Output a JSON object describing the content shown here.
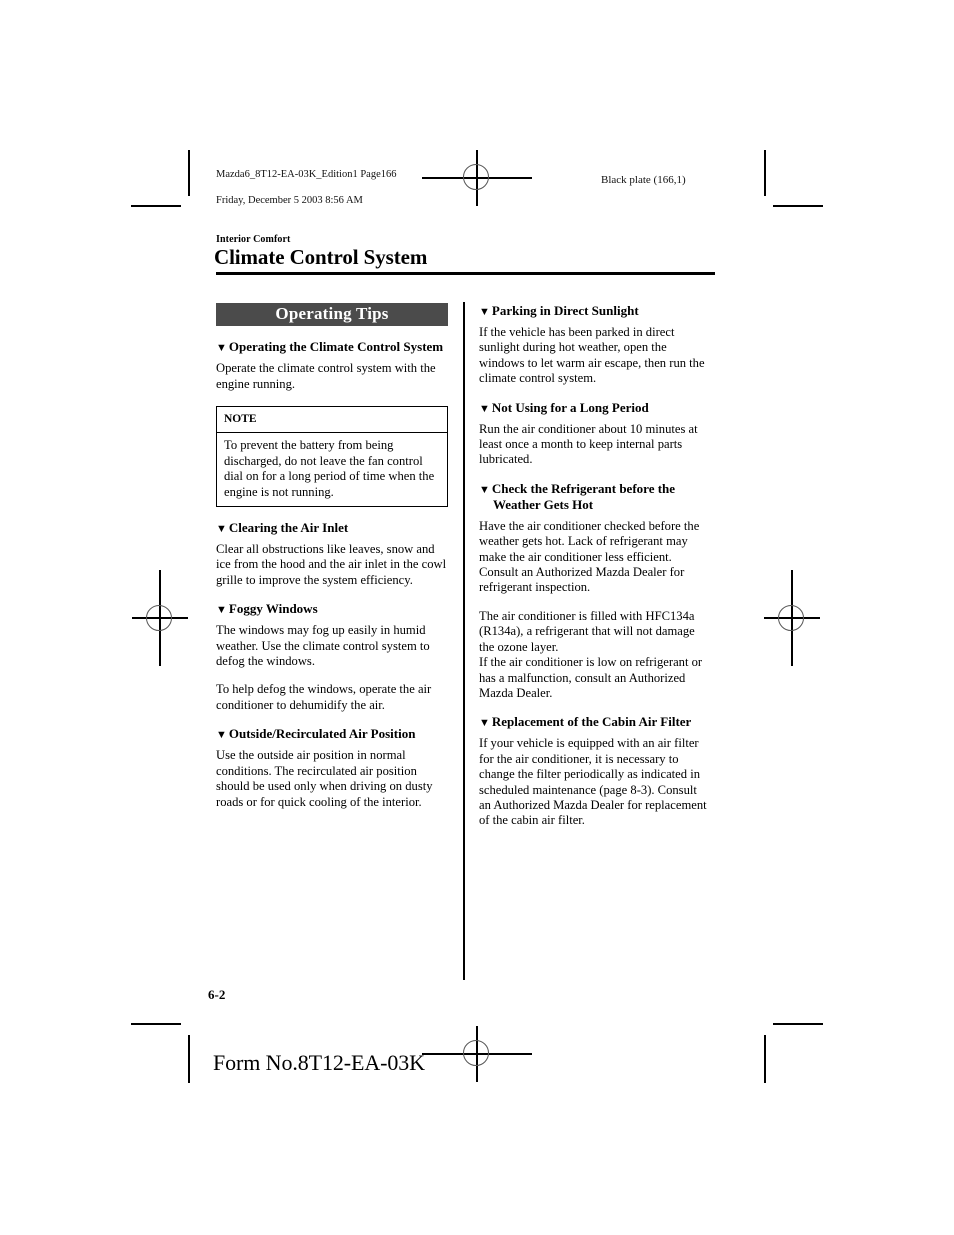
{
  "imprint": {
    "left_line1": "Mazda6_8T12-EA-03K_Edition1 Page166",
    "left_line2": "Friday, December 5 2003 8:56 AM",
    "right": "Black plate (166,1)"
  },
  "header": {
    "eyebrow": "Interior Comfort",
    "title": "Climate Control System"
  },
  "left_column": {
    "band_label": "Operating Tips",
    "sections": [
      {
        "marker": "▼",
        "heading": "Operating the Climate Control System",
        "paragraphs": [
          "Operate the climate control system with the engine running."
        ]
      },
      {
        "marker": "▼",
        "heading": "Clearing the Air Inlet",
        "paragraphs": [
          "Clear all obstructions like leaves, snow and ice from the hood and the air inlet in the cowl grille to improve the system efficiency."
        ]
      },
      {
        "marker": "▼",
        "heading": "Foggy Windows",
        "paragraphs": [
          "The windows may fog up easily in humid weather. Use the climate control system to defog the windows.",
          "To help defog the windows, operate the air conditioner to dehumidify the air."
        ]
      },
      {
        "marker": "▼",
        "heading": "Outside/Recirculated Air Position",
        "paragraphs": [
          "Use the outside air position in normal conditions. The recirculated air position should be used only when driving on dusty roads or for quick cooling of the interior."
        ]
      }
    ],
    "note": {
      "title": "NOTE",
      "text": "To prevent the battery from being discharged, do not leave the fan control dial on for a long period of time when the engine is not running."
    }
  },
  "right_column": {
    "sections": [
      {
        "marker": "▼",
        "heading": "Parking in Direct Sunlight",
        "paragraphs": [
          "If the vehicle has been parked in direct sunlight during hot weather, open the windows to let warm air escape, then run the climate control system."
        ]
      },
      {
        "marker": "▼",
        "heading": "Not Using for a Long Period",
        "paragraphs": [
          "Run the air conditioner about 10 minutes at least once a month to keep internal parts lubricated."
        ]
      },
      {
        "marker": "▼",
        "heading": "Check the Refrigerant before the Weather Gets Hot",
        "paragraphs": [
          "Have the air conditioner checked before the weather gets hot. Lack of refrigerant may make the air conditioner less efficient. Consult an Authorized Mazda Dealer for refrigerant inspection.",
          "The air conditioner is filled with HFC134a (R134a), a refrigerant that will not damage the ozone layer.\nIf the air conditioner is low on refrigerant or has a malfunction, consult an Authorized Mazda Dealer."
        ]
      },
      {
        "marker": "▼",
        "heading": "Replacement of the Cabin Air Filter",
        "paragraphs": [
          "If your vehicle is equipped with an air filter for the air conditioner, it is necessary to change the filter periodically as indicated in scheduled maintenance (page 8-3). Consult an Authorized Mazda Dealer for replacement of the cabin air filter."
        ]
      }
    ]
  },
  "footer": {
    "folio": "6-2",
    "form_no": "Form No.8T12-EA-03K"
  },
  "colors": {
    "band_background": "#4b4b4b",
    "band_text": "#ffffff",
    "rule": "#000000"
  }
}
